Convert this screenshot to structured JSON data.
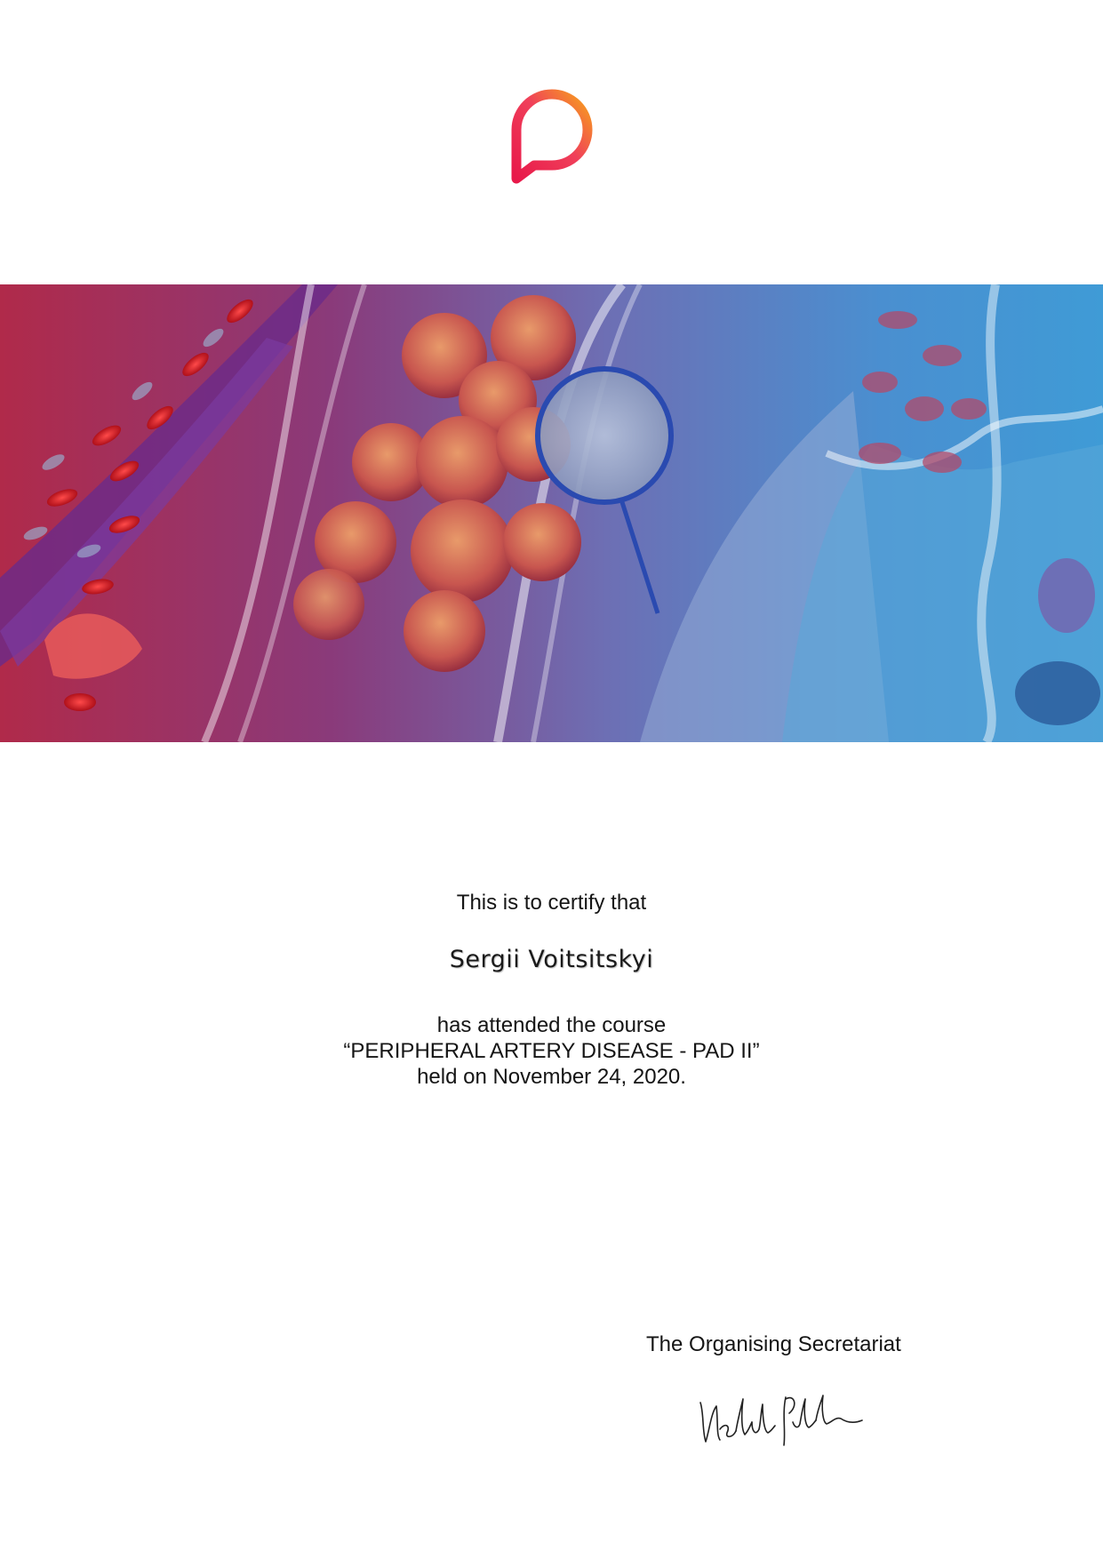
{
  "logo": {
    "icon": "speech-bubble-p-logo-icon",
    "gradient_start": "#e8194a",
    "gradient_end": "#f7a21b"
  },
  "banner": {
    "icon": "blood-vessel-illustration",
    "colors": {
      "left": "#b02a4a",
      "middle": "#7b3a8c",
      "right": "#4a8fd0"
    }
  },
  "certificate": {
    "intro": "This is to certify that",
    "recipient": "Sergii Voitsitskyi",
    "attended_line": "has attended the course",
    "course_title": "“PERIPHERAL ARTERY DISEASE - PAD II”",
    "date_line": "held on November 24, 2020."
  },
  "footer": {
    "signatory": "The Organising Secretariat",
    "signature_icon": "handwritten-signature"
  }
}
